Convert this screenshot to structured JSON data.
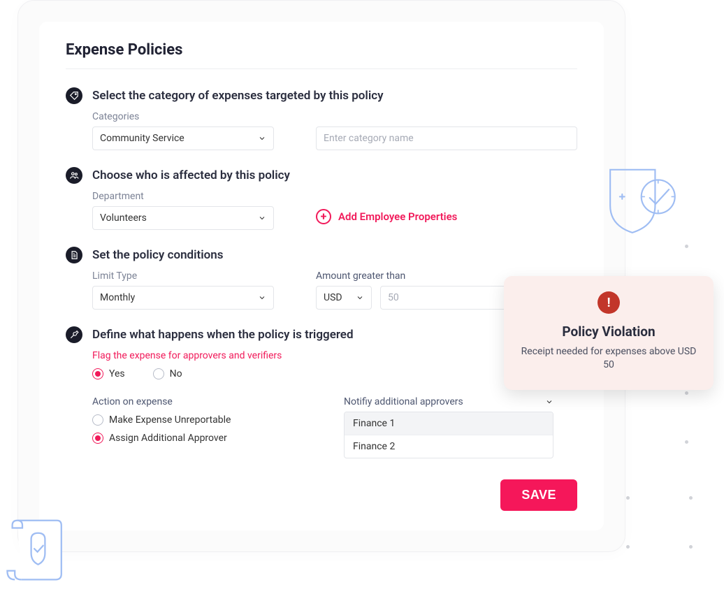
{
  "page_title": "Expense Policies",
  "sections": {
    "category": {
      "title": "Select the category of expenses targeted by this policy",
      "field_label": "Categories",
      "selected": "Community Service",
      "name_placeholder": "Enter category name"
    },
    "affected": {
      "title": "Choose who is affected by this policy",
      "field_label": "Department",
      "selected": "Volunteers",
      "add_link": "Add Employee Properties"
    },
    "conditions": {
      "title": "Set the policy conditions",
      "limit_label": "Limit Type",
      "limit_selected": "Monthly",
      "amount_label": "Amount greater than",
      "currency": "USD",
      "amount_placeholder": "50"
    },
    "actions": {
      "title": "Define what happens when the policy is triggered",
      "flag_label": "Flag the expense for approvers and verifiers",
      "yes": "Yes",
      "no": "No",
      "action_label": "Action on expense",
      "opt_unreportable": "Make Expense Unreportable",
      "opt_assign": "Assign Additional Approver",
      "notify_label": "Notifiy additional approvers",
      "approvers": [
        "Finance 1",
        "Finance 2"
      ]
    }
  },
  "save_label": "SAVE",
  "toast": {
    "title": "Policy Violation",
    "message": "Receipt needed for expenses above USD 50"
  }
}
